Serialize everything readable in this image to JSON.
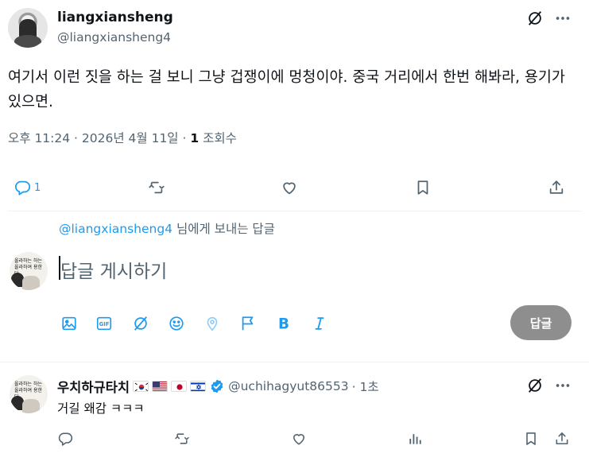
{
  "main_tweet": {
    "display_name": "liangxiansheng",
    "handle": "@liangxiansheng4",
    "text": "여기서 이런 짓을 하는 걸 보니 그냥 겁쟁이에 멍청이야. 중국 거리에서 한번 해봐라, 용기가 있으면.",
    "time": "오후 11:24 · 2026년 4월 11일 · ",
    "views_count": "1",
    "views_label": " 조회수",
    "reply_count": "1"
  },
  "reply_context": {
    "handle": "@liangxiansheng4",
    "suffix": " 님에게 보내는 답글"
  },
  "composer": {
    "placeholder": "답글 게시하기",
    "submit_label": "답글"
  },
  "avatar_text": {
    "line1": "올라하는 하는",
    "line2": "올라하여 용한다"
  },
  "reply_tweet": {
    "display_name": "우치하규타치",
    "handle": "@uchihagyut86553",
    "time": " · 1초",
    "text": "거길 왜감 ㅋㅋㅋ",
    "flags": [
      "korea-flag",
      "usa-flag",
      "japan-flag",
      "israel-flag"
    ]
  },
  "colors": {
    "accent": "#1d9bf0",
    "muted": "#536471",
    "verified": "#1d9bf0",
    "disabled_button": "#8e8e8e"
  }
}
